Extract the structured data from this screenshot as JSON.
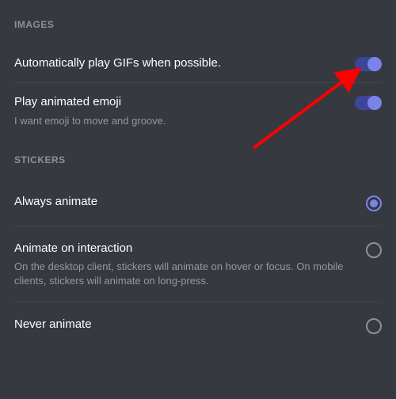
{
  "colors": {
    "accent": "#7a84e8",
    "bg": "#36393f",
    "header": "#8e9297"
  },
  "sections": {
    "images": {
      "header": "IMAGES",
      "items": [
        {
          "title": "Automatically play GIFs when possible.",
          "subtitle": "",
          "toggle": true
        },
        {
          "title": "Play animated emoji",
          "subtitle": "I want emoji to move and groove.",
          "toggle": true
        }
      ]
    },
    "stickers": {
      "header": "STICKERS",
      "items": [
        {
          "title": "Always animate",
          "subtitle": "",
          "selected": true
        },
        {
          "title": "Animate on interaction",
          "subtitle": "On the desktop client, stickers will animate on hover or focus. On mobile clients, stickers will animate on long-press.",
          "selected": false
        },
        {
          "title": "Never animate",
          "subtitle": "",
          "selected": false
        }
      ]
    }
  },
  "annotation": {
    "type": "arrow",
    "color": "#ff0000",
    "target": "auto-play-gifs-toggle"
  }
}
